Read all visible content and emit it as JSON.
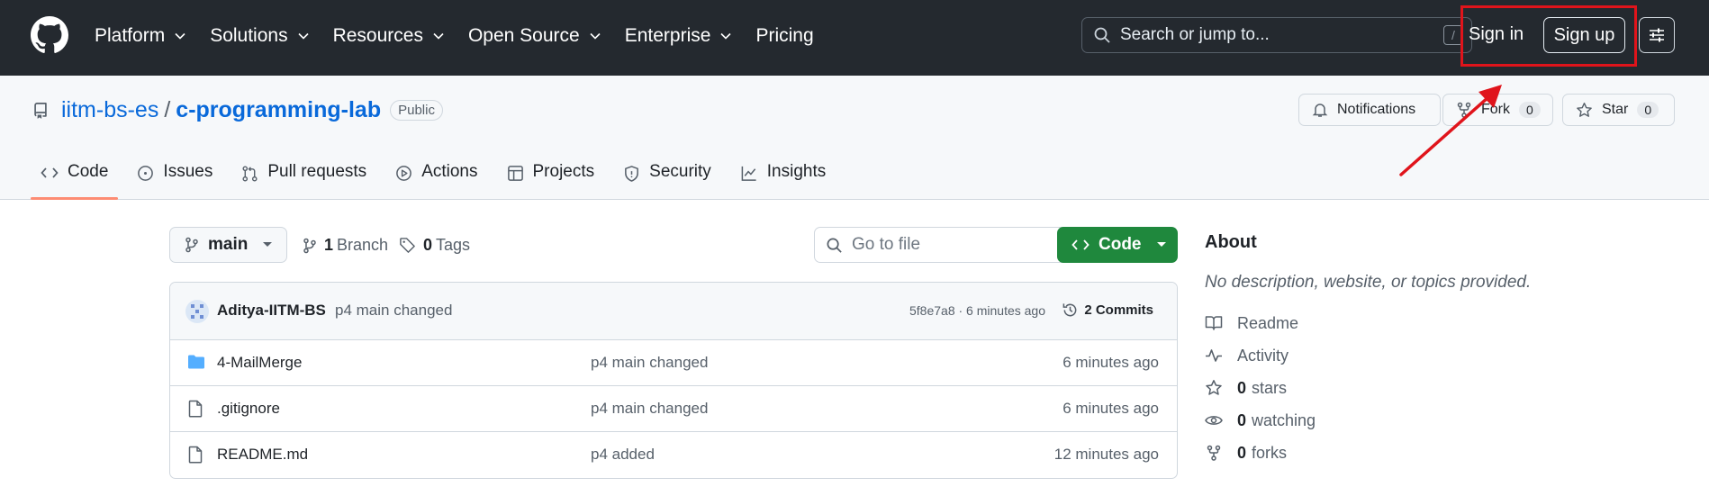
{
  "header": {
    "nav": [
      {
        "label": "Platform",
        "dropdown": true
      },
      {
        "label": "Solutions",
        "dropdown": true
      },
      {
        "label": "Resources",
        "dropdown": true
      },
      {
        "label": "Open Source",
        "dropdown": true
      },
      {
        "label": "Enterprise",
        "dropdown": true
      },
      {
        "label": "Pricing",
        "dropdown": false
      }
    ],
    "search_placeholder": "Search or jump to...",
    "search_shortcut": "/",
    "signin_label": "Sign in",
    "signup_label": "Sign up",
    "highlight_color": "#e0141b"
  },
  "repo": {
    "owner": "iitm-bs-es",
    "separator": "/",
    "name": "c-programming-lab",
    "visibility": "Public",
    "notifications_label": "Notifications",
    "fork_label": "Fork",
    "fork_count": "0",
    "star_label": "Star",
    "star_count": "0"
  },
  "tabs": [
    {
      "label": "Code",
      "icon": "code-icon",
      "active": true
    },
    {
      "label": "Issues",
      "icon": "issue-icon",
      "active": false
    },
    {
      "label": "Pull requests",
      "icon": "pull-request-icon",
      "active": false
    },
    {
      "label": "Actions",
      "icon": "play-icon",
      "active": false
    },
    {
      "label": "Projects",
      "icon": "table-icon",
      "active": false
    },
    {
      "label": "Security",
      "icon": "shield-icon",
      "active": false
    },
    {
      "label": "Insights",
      "icon": "graph-icon",
      "active": false
    }
  ],
  "toolbar": {
    "branch": "main",
    "branch_count": "1",
    "branch_label": "Branch",
    "tag_count": "0",
    "tag_label": "Tags",
    "gofile_placeholder": "Go to file",
    "code_label": "Code"
  },
  "commit": {
    "author": "Aditya-IITM-BS",
    "message": "p4 main changed",
    "hash_time": "5f8e7a8 · 6 minutes ago",
    "commits_label": "2 Commits"
  },
  "files": [
    {
      "name": "4-MailMerge",
      "type": "folder",
      "message": "p4 main changed",
      "time": "6 minutes ago"
    },
    {
      "name": ".gitignore",
      "type": "file",
      "message": "p4 main changed",
      "time": "6 minutes ago"
    },
    {
      "name": "README.md",
      "type": "file",
      "message": "p4 added",
      "time": "12 minutes ago"
    }
  ],
  "about": {
    "title": "About",
    "description": "No description, website, or topics provided.",
    "items": [
      {
        "icon": "book-icon",
        "count": "",
        "label": "Readme"
      },
      {
        "icon": "pulse-icon",
        "count": "",
        "label": "Activity"
      },
      {
        "icon": "star-icon",
        "count": "0",
        "label": "stars"
      },
      {
        "icon": "eye-icon",
        "count": "0",
        "label": "watching"
      },
      {
        "icon": "fork-icon",
        "count": "0",
        "label": "forks"
      }
    ]
  }
}
